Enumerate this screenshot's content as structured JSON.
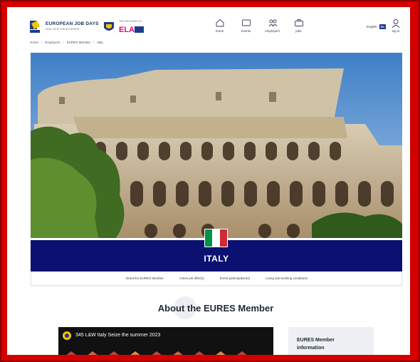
{
  "header": {
    "logo_title": "EUROPEAN JOB DAYS",
    "logo_subtitle": "FIND YOUR JOB IN EUROPE",
    "logo_ela_label": "THE PARTNERS OF",
    "logo_ela_text": "ELA",
    "nav": [
      {
        "label": "home",
        "icon": "home-icon"
      },
      {
        "label": "events",
        "icon": "monitor-icon"
      },
      {
        "label": "employers",
        "icon": "people-icon"
      },
      {
        "label": "jobs",
        "icon": "briefcase-icon"
      }
    ],
    "language": "English",
    "language_code": "EN",
    "login": "log in"
  },
  "breadcrumb": [
    "Home",
    "Employers",
    "EURES Member",
    "Italy"
  ],
  "banner": {
    "country": "ITALY",
    "flag_colors": [
      "#009246",
      "#ffffff",
      "#ce2b37"
    ],
    "background": "#0a1170"
  },
  "tabs": [
    "About the EURES Member",
    "Active job offer(s)",
    "Event participation(s)",
    "Living and working conditions"
  ],
  "section": {
    "title": "About the EURES Member"
  },
  "video": {
    "title": "345 L&W Italy Seize the summer 2023"
  },
  "info_card": {
    "title": "EURES Member information"
  },
  "colors": {
    "frame": "#d40000",
    "accent": "#0a1170"
  }
}
